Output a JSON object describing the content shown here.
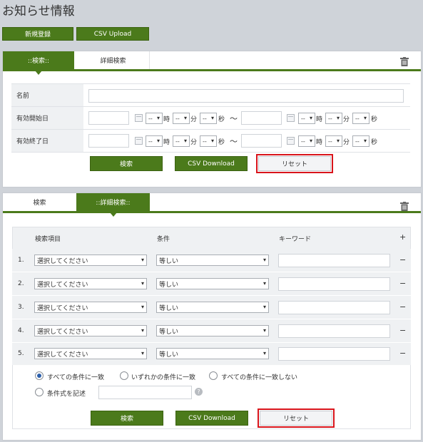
{
  "page_title": "お知らせ情報",
  "buttons": {
    "new": "新規登録",
    "csv_upload": "CSV Upload"
  },
  "top": {
    "tabs": [
      {
        "label": "::検索::"
      },
      {
        "label": "詳細検索"
      }
    ],
    "fields": {
      "name": "名前",
      "start": "有効開始日",
      "end": "有効終了日"
    },
    "time_units": {
      "hour": "時",
      "min": "分",
      "sec": "秒",
      "range": "〜"
    },
    "select_default": "--",
    "actions": {
      "search": "検索",
      "csv": "CSV Download",
      "reset": "リセット"
    }
  },
  "bottom": {
    "tabs": [
      {
        "label": "検索"
      },
      {
        "label": "::詳細検索::"
      }
    ],
    "headers": {
      "item": "検索項目",
      "cond": "条件",
      "keyword": "キーワード",
      "add": "+"
    },
    "rows": [
      {
        "no": "1.",
        "item": "選択してください",
        "cond": "等しい",
        "remove": "−"
      },
      {
        "no": "2.",
        "item": "選択してください",
        "cond": "等しい",
        "remove": "−"
      },
      {
        "no": "3.",
        "item": "選択してください",
        "cond": "等しい",
        "remove": "−"
      },
      {
        "no": "4.",
        "item": "選択してください",
        "cond": "等しい",
        "remove": "−"
      },
      {
        "no": "5.",
        "item": "選択してください",
        "cond": "等しい",
        "remove": "−"
      }
    ],
    "radios": {
      "all": "すべての条件に一致",
      "any": "いずれかの条件に一致",
      "none": "すべての条件に一致しない",
      "formula": "条件式を記述"
    },
    "help": "?",
    "actions": {
      "search": "検索",
      "csv": "CSV Download",
      "reset": "リセット"
    }
  },
  "colors": {
    "accent": "#4b7a1b",
    "highlight": "#d9141b"
  },
  "icons": {
    "trash": "trash-icon",
    "calendar": "calendar-icon",
    "help": "help-icon"
  }
}
